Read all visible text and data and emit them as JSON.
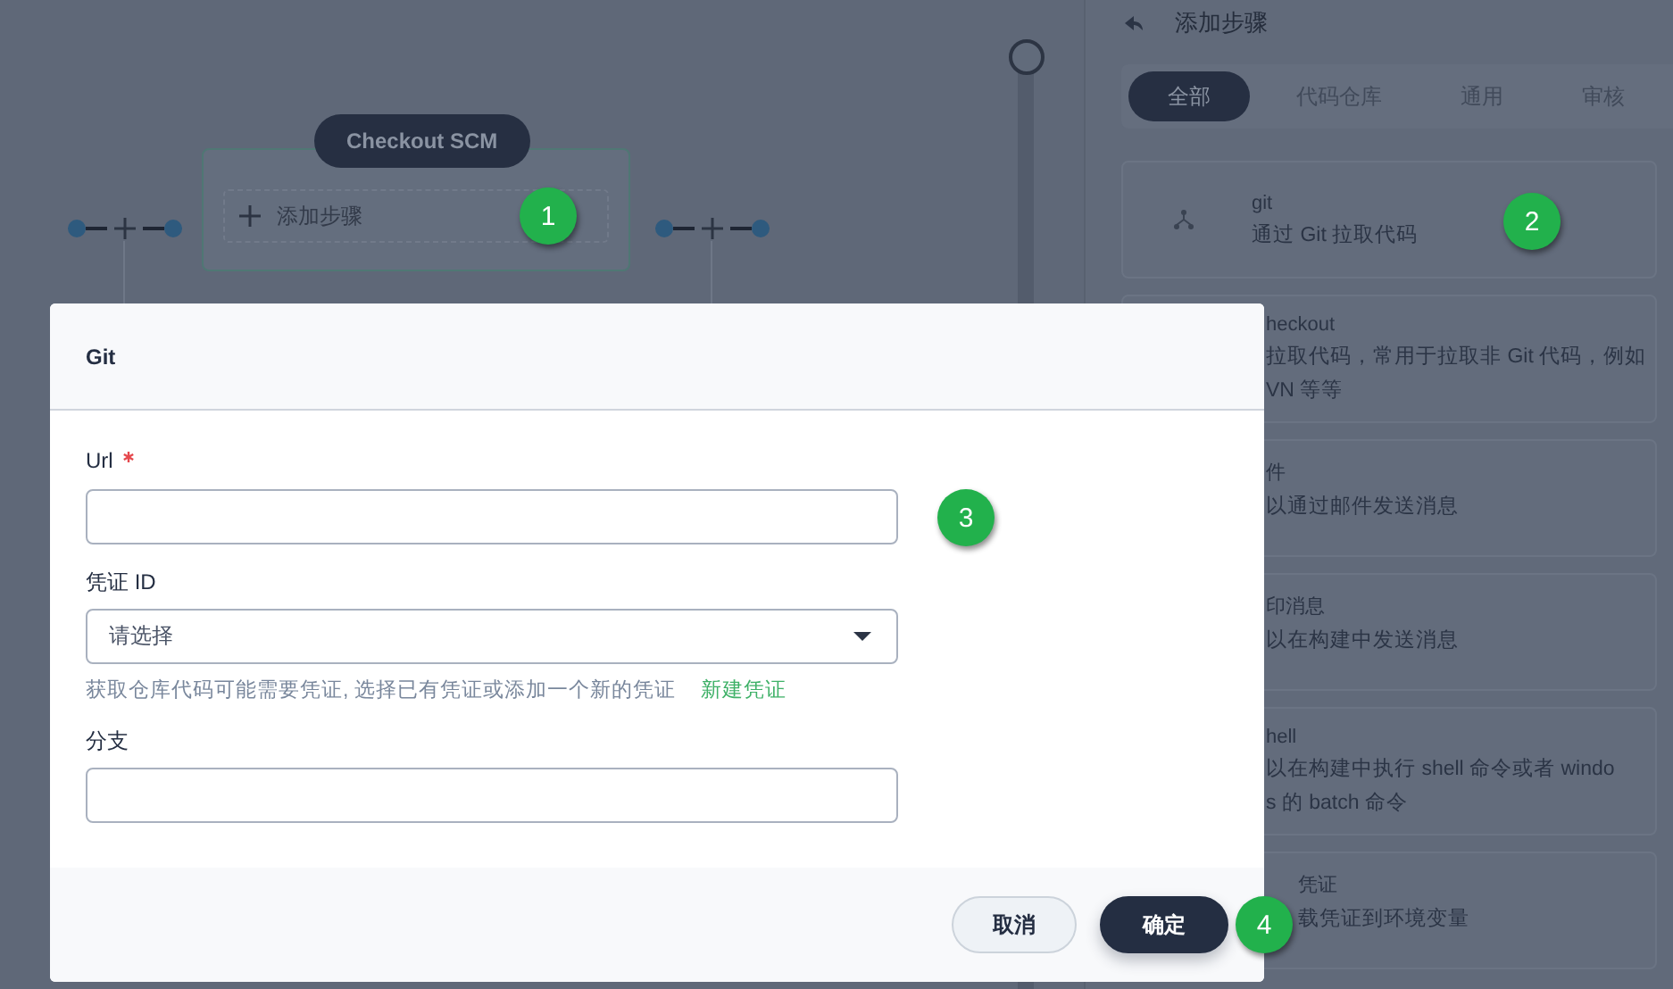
{
  "canvas": {
    "stage": {
      "title": "Checkout SCM",
      "add_step": "添加步骤"
    }
  },
  "panel": {
    "title": "添加步骤",
    "tabs": [
      {
        "label": "全部",
        "selected": true
      },
      {
        "label": "代码仓库",
        "selected": false
      },
      {
        "label": "通用",
        "selected": false
      },
      {
        "label": "审核",
        "selected": false
      }
    ],
    "steps": [
      {
        "covered": false,
        "name": "git",
        "description_lines": [
          "通过 Git 拉取代码"
        ]
      },
      {
        "covered": true,
        "name": "heckout",
        "description_lines": [
          "拉取代码，常用于拉取非 Git 代码，例如",
          "VN 等等"
        ]
      },
      {
        "covered": true,
        "name": "件",
        "description_lines": [
          "以通过邮件发送消息"
        ]
      },
      {
        "covered": true,
        "name": "印消息",
        "description_lines": [
          "以在构建中发送消息"
        ]
      },
      {
        "covered": true,
        "name": "hell",
        "description_lines": [
          "以在构建中执行 shell 命令或者 windo",
          "s 的 batch 命令"
        ]
      },
      {
        "covered": true,
        "name": "凭证",
        "description_lines": [
          "载凭证到环境变量"
        ]
      }
    ]
  },
  "dialog": {
    "title": "Git",
    "fields": [
      {
        "kind": "input",
        "label": "Url",
        "required": true
      },
      {
        "kind": "select",
        "label": "凭证 ID",
        "required": false,
        "placeholder": "请选择",
        "help": "获取仓库代码可能需要凭证, 选择已有凭证或添加一个新的凭证",
        "link": "新建凭证"
      },
      {
        "kind": "input",
        "label": "分支",
        "required": false
      }
    ],
    "buttons": [
      {
        "label": "取消",
        "kind": "secondary"
      },
      {
        "label": "确定",
        "kind": "primary"
      }
    ]
  },
  "callouts": [
    "1",
    "2",
    "3",
    "4"
  ]
}
